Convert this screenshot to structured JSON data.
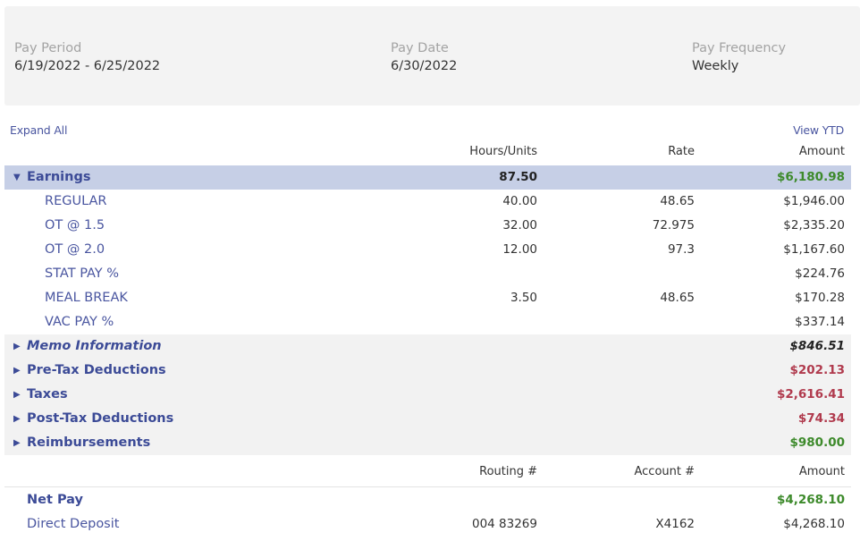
{
  "header": {
    "pay_period_label": "Pay Period",
    "pay_period_value": "6/19/2022 - 6/25/2022",
    "pay_date_label": "Pay Date",
    "pay_date_value": "6/30/2022",
    "pay_frequency_label": "Pay Frequency",
    "pay_frequency_value": "Weekly"
  },
  "links": {
    "expand_all": "Expand All",
    "view_ytd": "View YTD"
  },
  "columns": {
    "hours": "Hours/Units",
    "rate": "Rate",
    "amount": "Amount"
  },
  "earnings": {
    "label": "Earnings",
    "hours": "87.50",
    "amount": "$6,180.98",
    "items": [
      {
        "label": "REGULAR",
        "hours": "40.00",
        "rate": "48.65",
        "amount": "$1,946.00"
      },
      {
        "label": "OT @ 1.5",
        "hours": "32.00",
        "rate": "72.975",
        "amount": "$2,335.20"
      },
      {
        "label": "OT @ 2.0",
        "hours": "12.00",
        "rate": "97.3",
        "amount": "$1,167.60"
      },
      {
        "label": "STAT PAY %",
        "hours": "",
        "rate": "",
        "amount": "$224.76"
      },
      {
        "label": "MEAL BREAK",
        "hours": "3.50",
        "rate": "48.65",
        "amount": "$170.28"
      },
      {
        "label": "VAC PAY %",
        "hours": "",
        "rate": "",
        "amount": "$337.14"
      }
    ]
  },
  "sections": [
    {
      "label": "Memo Information",
      "amount": "$846.51"
    },
    {
      "label": "Pre-Tax Deductions",
      "amount": "$202.13"
    },
    {
      "label": "Taxes",
      "amount": "$2,616.41"
    },
    {
      "label": "Post-Tax Deductions",
      "amount": "$74.34"
    },
    {
      "label": "Reimbursements",
      "amount": "$980.00"
    }
  ],
  "netpay_columns": {
    "routing": "Routing #",
    "account": "Account #",
    "amount": "Amount"
  },
  "net_pay": {
    "label": "Net Pay",
    "amount": "$4,268.10",
    "deposit_label": "Direct Deposit",
    "routing": "004 83269",
    "account": "X4162",
    "deposit_amount": "$4,268.10"
  },
  "icons": {
    "expanded": "triangle-down-icon",
    "collapsed": "triangle-right-icon"
  },
  "colors": {
    "accent": "#3c4b97",
    "positive": "#3d8a2b",
    "negative": "#b03a4d",
    "earnings_bg": "#c6cfe6",
    "section_bg": "#f2f2f2"
  }
}
